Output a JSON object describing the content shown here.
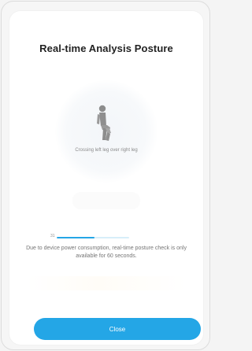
{
  "dialog": {
    "title": "Real-time Analysis Posture",
    "posture_label": "Crossing left leg over right leg",
    "note_text": "Due to device power consumption, real-time posture check is only available for 60 seconds.",
    "close_label": "Close"
  },
  "progress": {
    "value_text": "31",
    "fraction": 0.52
  },
  "icons": {
    "posture_icon": "person-sitting-crossed-legs-icon"
  },
  "colors": {
    "accent": "#24a6e6",
    "track": "#d7eef9",
    "text_primary": "#222222",
    "text_secondary": "#8a8a8a",
    "background": "#f6f6f6",
    "card": "#ffffff"
  }
}
